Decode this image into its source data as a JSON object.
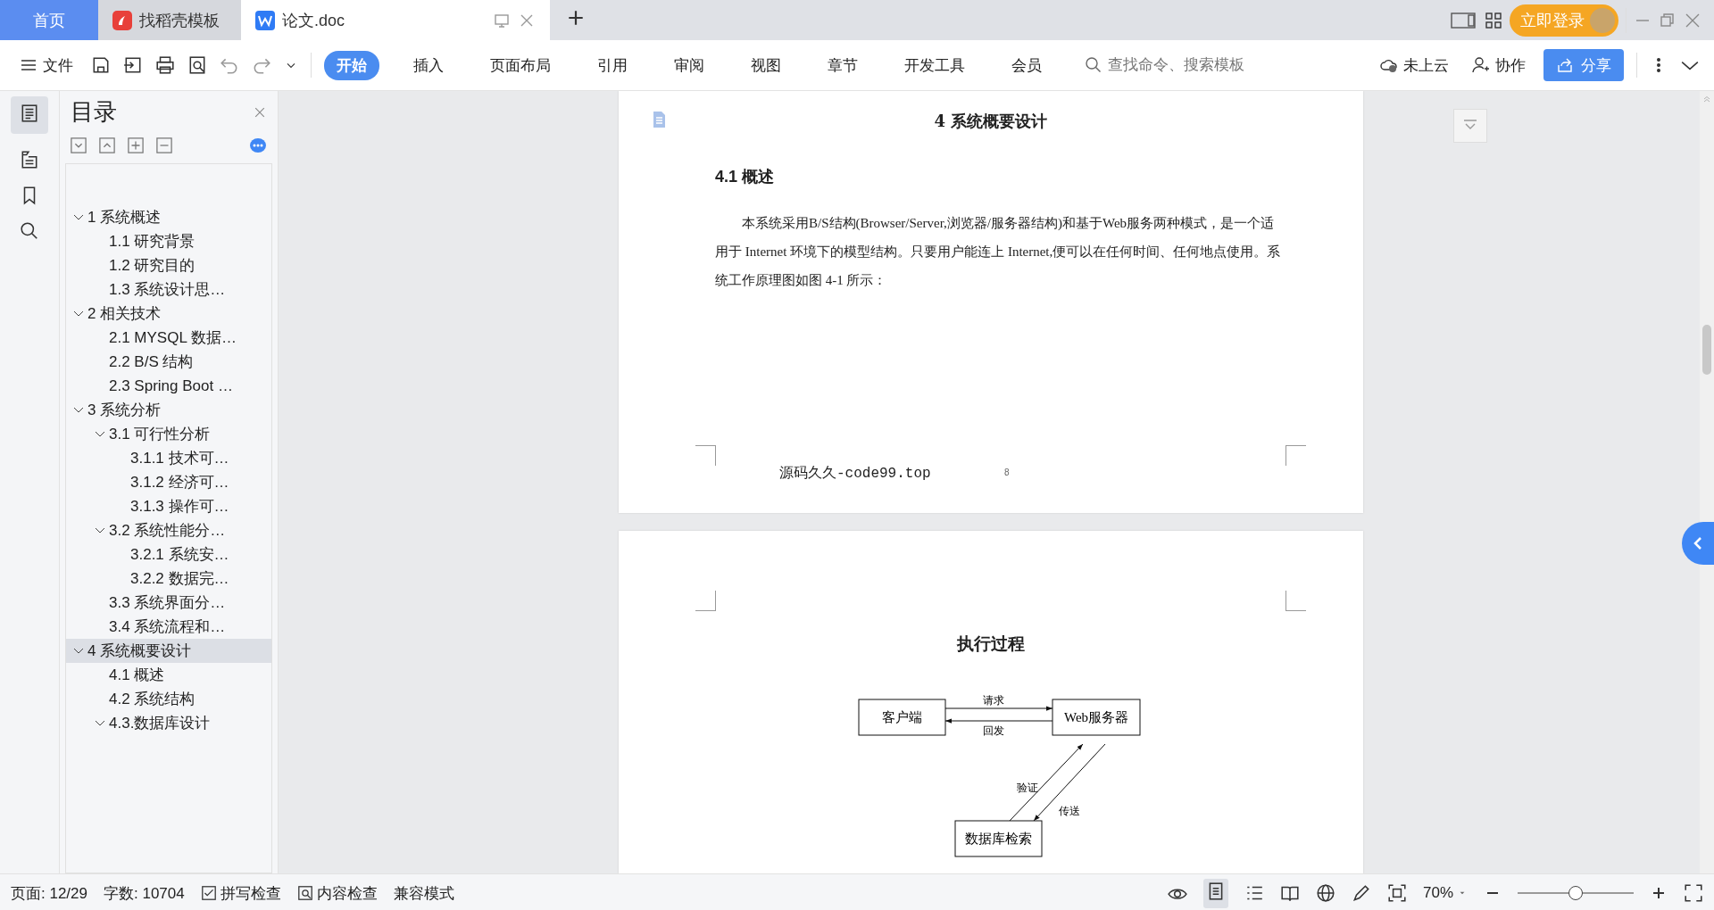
{
  "tabs": [
    {
      "label": "首页",
      "kind": "home",
      "selected": false
    },
    {
      "label": "找稻壳模板",
      "kind": "template",
      "selected": false
    },
    {
      "label": "论文.doc",
      "kind": "doc",
      "selected": true
    }
  ],
  "account": {
    "login": "立即登录"
  },
  "toolbar": {
    "file_menu": "文件",
    "ribbon_tabs": [
      {
        "label": "开始",
        "selected": true
      },
      {
        "label": "插入",
        "selected": false
      },
      {
        "label": "页面布局",
        "selected": false
      },
      {
        "label": "引用",
        "selected": false
      },
      {
        "label": "审阅",
        "selected": false
      },
      {
        "label": "视图",
        "selected": false
      },
      {
        "label": "章节",
        "selected": false
      },
      {
        "label": "开发工具",
        "selected": false
      },
      {
        "label": "会员",
        "selected": false
      }
    ],
    "search": {
      "placeholder": "查找命令、搜索模板"
    },
    "cloud": "未上云",
    "collaborate": "协作",
    "share": "分享"
  },
  "sidebar": {
    "title": "目录",
    "toc": [
      {
        "label": "1 系统概述",
        "expanded": true,
        "selected": false,
        "children": [
          {
            "label": "1.1  研究背景",
            "selected": false
          },
          {
            "label": "1.2 研究目的",
            "selected": false
          },
          {
            "label": "1.3 系统设计思…",
            "selected": false
          }
        ]
      },
      {
        "label": "2 相关技术",
        "expanded": true,
        "selected": false,
        "children": [
          {
            "label": "2.1 MYSQL 数据…",
            "selected": false
          },
          {
            "label": "2.2 B/S 结构",
            "selected": false
          },
          {
            "label": "2.3 Spring Boot …",
            "selected": false
          }
        ]
      },
      {
        "label": "3 系统分析",
        "expanded": true,
        "selected": false,
        "children": [
          {
            "label": "3.1 可行性分析",
            "expanded": true,
            "selected": false,
            "children": [
              {
                "label": "3.1.1 技术可…",
                "selected": false
              },
              {
                "label": "3.1.2 经济可…",
                "selected": false
              },
              {
                "label": "3.1.3 操作可…",
                "selected": false
              }
            ]
          },
          {
            "label": "3.2 系统性能分…",
            "expanded": true,
            "selected": false,
            "children": [
              {
                "label": "3.2.1  系统安…",
                "selected": false
              },
              {
                "label": "3.2.2  数据完…",
                "selected": false
              }
            ]
          },
          {
            "label": "3.3 系统界面分…",
            "selected": false
          },
          {
            "label": "3.4 系统流程和…",
            "selected": false
          }
        ]
      },
      {
        "label": "4 系统概要设计",
        "expanded": true,
        "selected": true,
        "children": [
          {
            "label": "4.1 概述",
            "selected": false
          },
          {
            "label": "4.2 系统结构",
            "selected": false
          },
          {
            "label": "4.3.数据库设计",
            "expanded": true,
            "selected": false
          }
        ]
      }
    ]
  },
  "document": {
    "page1": {
      "chapter_heading": "4 系统概要设计",
      "section_heading": "4.1 概述",
      "paragraph": "本系统采用B/S结构(Browser/Server,浏览器/服务器结构)和基于Web服务两种模式，是一个适用于 Internet 环境下的模型结构。只要用户能连上 Internet,便可以在任何时间、任何地点使用。系统工作原理图如图 4-1 所示：",
      "footer": "源码久久-code99.top",
      "page_number": "8"
    },
    "page2": {
      "diagram_title": "执行过程",
      "nodes": [
        "客户端",
        "Web服务器",
        "数据库检索"
      ],
      "edges": [
        {
          "label": "请求"
        },
        {
          "label": "回发"
        },
        {
          "label": "验证"
        },
        {
          "label": "传送"
        }
      ]
    }
  },
  "status_bar": {
    "page": "页面: 12/29",
    "words": "字数: 10704",
    "spell_check": "拼写检查",
    "content_check": "内容检查",
    "compat_mode": "兼容模式",
    "zoom": "70%",
    "zoom_slider": {
      "level": 0.5
    }
  }
}
